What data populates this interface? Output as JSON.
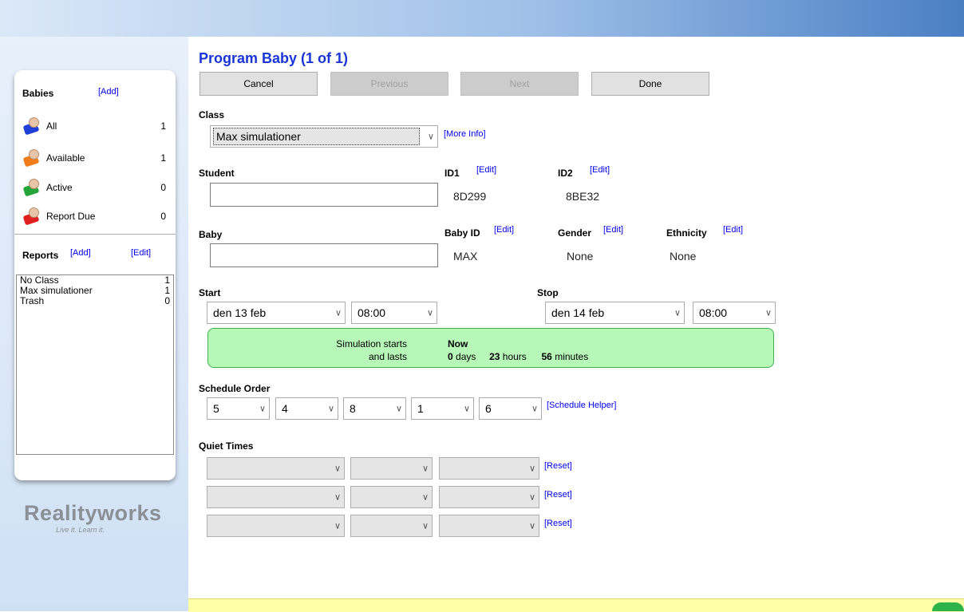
{
  "page": {
    "title": "Program Baby (1 of 1)"
  },
  "buttons": {
    "cancel": "Cancel",
    "previous": "Previous",
    "next": "Next",
    "done": "Done"
  },
  "sidebar": {
    "babies_heading": "Babies",
    "add_link": "[Add]",
    "baby_groups": [
      {
        "label": "All",
        "count": "1",
        "color": "#1f3fd8"
      },
      {
        "label": "Available",
        "count": "1",
        "color": "#f07d1a"
      },
      {
        "label": "Active",
        "count": "0",
        "color": "#23a53a"
      },
      {
        "label": "Report Due",
        "count": "0",
        "color": "#e02020"
      }
    ],
    "reports_heading": "Reports",
    "reports_add": "[Add]",
    "reports_edit": "[Edit]",
    "reports": [
      {
        "label": "No Class",
        "count": "1"
      },
      {
        "label": "Max simulationer",
        "count": "1"
      },
      {
        "label": "Trash",
        "count": "0"
      }
    ]
  },
  "logo": {
    "word": "Realityworks",
    "tagline": "Live it. Learn it."
  },
  "form": {
    "class_label": "Class",
    "class_value": "Max simulationer",
    "more_info": "[More Info]",
    "student_label": "Student",
    "id1_label": "ID1",
    "id1_value": "8D299",
    "id2_label": "ID2",
    "id2_value": "8BE32",
    "edit_link": "[Edit]",
    "baby_label": "Baby",
    "baby_id_label": "Baby ID",
    "baby_id_value": "MAX",
    "gender_label": "Gender",
    "gender_value": "None",
    "ethnicity_label": "Ethnicity",
    "ethnicity_value": "None",
    "start_label": "Start",
    "start_date": "den 13 feb",
    "start_time": "08:00",
    "stop_label": "Stop",
    "stop_date": "den 14 feb",
    "stop_time": "08:00",
    "sim_starts_label": "Simulation starts",
    "sim_lasts_label": "and lasts",
    "sim_start_value": "Now",
    "sim_days": "0",
    "sim_days_unit": "days",
    "sim_hours": "23",
    "sim_hours_unit": "hours",
    "sim_minutes": "56",
    "sim_minutes_unit": "minutes",
    "schedule_label": "Schedule Order",
    "schedule_values": [
      "5",
      "4",
      "8",
      "1",
      "6"
    ],
    "schedule_helper": "[Schedule Helper]",
    "quiet_label": "Quiet Times",
    "reset_link": "[Reset]"
  }
}
